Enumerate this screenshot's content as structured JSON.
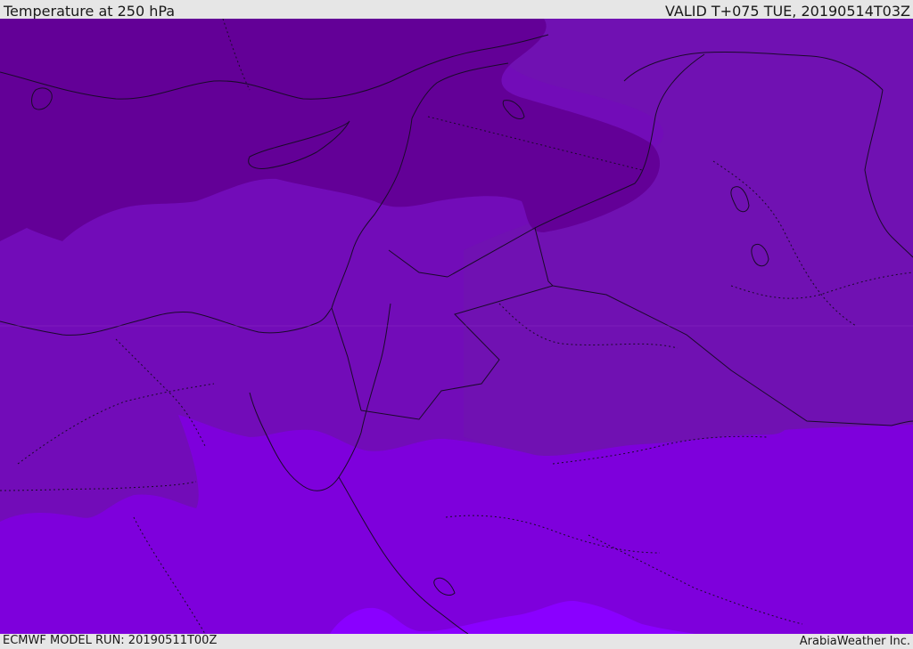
{
  "header": {
    "title": "Temperature at 250 hPa",
    "valid_time": "VALID T+075 TUE, 20190514T03Z"
  },
  "footer": {
    "model_run": "ECMWF MODEL RUN: 20190511T00Z",
    "credit": "ArabiaWeather Inc."
  },
  "map": {
    "colors": {
      "coldest_band": "#630097",
      "cold_band": "#7011b2",
      "mid_band": "#720cb8",
      "warm_band": "#7e00dc",
      "warmest_band": "#8a00ff",
      "coastline": "#1a0a2a"
    }
  }
}
